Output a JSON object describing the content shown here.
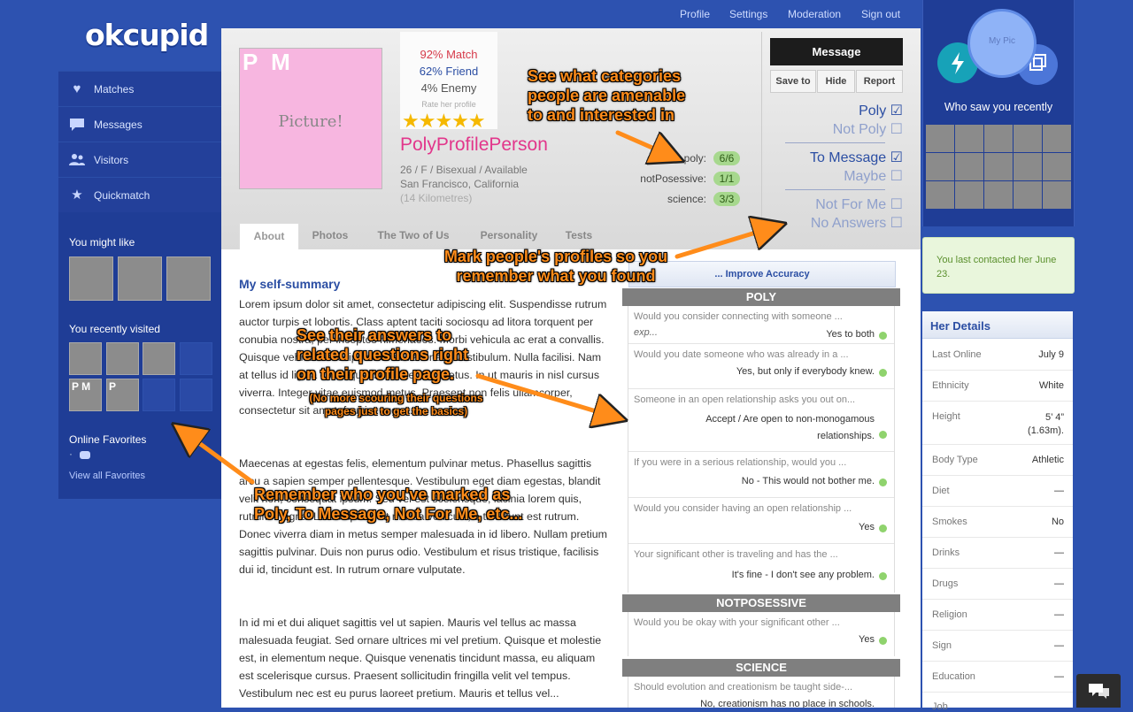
{
  "logo": "okcupid",
  "topnav": [
    "Profile",
    "Settings",
    "Moderation",
    "Sign out"
  ],
  "leftnav": [
    {
      "icon": "heart-icon",
      "glyph": "♥",
      "label": "Matches"
    },
    {
      "icon": "speech-bubble-icon",
      "glyph": "▬",
      "label": "Messages"
    },
    {
      "icon": "people-icon",
      "glyph": "☻",
      "label": "Visitors"
    },
    {
      "icon": "star-icon",
      "glyph": "★",
      "label": "Quickmatch"
    }
  ],
  "left": {
    "might_like": "You might like",
    "recently_visited": "You recently visited",
    "visited_labels": [
      "P M",
      "P"
    ],
    "online_fav": "Online Favorites",
    "online_fav_dot": "·",
    "view_all": "View all Favorites"
  },
  "profile": {
    "initials": "P M",
    "picture": "Picture!",
    "match": "92% Match",
    "friend": "62% Friend",
    "enemy": "4% Enemy",
    "rate": "Rate her profile",
    "stars": "★★★★★",
    "name": "PolyProfilePerson",
    "info": "26 / F / Bisexual / Available",
    "location": "San Francisco, California",
    "distance": "(14 Kilometres)",
    "rating": 5
  },
  "categories": [
    {
      "label": "poly:",
      "value": "6/6"
    },
    {
      "label": "notPosessive:",
      "value": "1/1"
    },
    {
      "label": "science:",
      "value": "3/3"
    }
  ],
  "actions": {
    "message": "Message",
    "save": "Save to",
    "hide": "Hide",
    "report": "Report"
  },
  "marks": [
    {
      "label": "Poly ☑",
      "active": true
    },
    {
      "label": "Not Poly ☐",
      "active": false
    },
    {
      "label": "To Message ☑",
      "active": true
    },
    {
      "label": "Maybe ☐",
      "active": false
    },
    {
      "label": "Not For Me ☐",
      "active": false
    },
    {
      "label": "No Answers ☐",
      "active": false
    }
  ],
  "tabs": [
    "About",
    "Photos",
    "The Two of Us",
    "Personality",
    "Tests"
  ],
  "summary": {
    "title": "My self-summary",
    "p1": "Lorem ipsum dolor sit amet, consectetur adipiscing elit. Suspendisse rutrum auctor turpis et lobortis. Class aptent taciti sociosqu ad litora torquent per conubia nostra, per inceptos himenaeos. Morbi vehicula ac erat a convallis. Quisque vehicula suscipit dolor et venenatis vestibulum. Nulla facilisi. Nam at tellus id ligula consequat sem libero at metus. In ut mauris in nisl cursus viverra. Integer vitae euismod metus. Praesent non felis ullamcorper, consectetur sit amet, feugiat augue.",
    "p2": "Maecenas at egestas felis, elementum pulvinar metus. Phasellus sagittis arcu a sapien semper pellentesque. Vestibulum eget diam egestas, blandit velit non, consequat ipsum. Sed vel est scelerisque, lacinia lorem quis, rutrum magna. Lorem ipsum at massa vehicula, a tincidunt est rutrum. Donec viverra diam in metus semper malesuada in id libero. Nullam pretium sagittis pulvinar. Duis non purus odio. Vestibulum et risus tristique, facilisis dui id, tincidunt est. In rutrum ornare vulputate.",
    "p3": "In id mi et dui aliquet sagittis vel ut sapien. Mauris vel tellus ac massa malesuada feugiat. Sed ornare ultrices mi vel pretium. Quisque et molestie est, in elementum neque. Quisque venenatis tincidunt massa, eu aliquam est scelerisque cursus. Praesent sollicitudin fringilla velit vel tempus. Vestibulum nec est eu purus laoreet pretium. Mauris et tellus vel..."
  },
  "questions": {
    "improve": "... Improve Accuracy",
    "sections": [
      {
        "title": "POLY",
        "items": [
          {
            "q": "Would you consider connecting with someone ...",
            "q2": "exp...",
            "a": "Yes to both"
          },
          {
            "q": "Would you date someone who was already in a ...",
            "a": "Yes, but only if everybody knew."
          },
          {
            "q": "Someone in an open relationship asks you out on...",
            "a": "Accept / Are open to non-monogamous relationships."
          },
          {
            "q": "If you were in a serious relationship, would you ...",
            "a": "No - This would not bother me."
          },
          {
            "q": "Would you consider having an open relationship ...",
            "a": "Yes"
          },
          {
            "q": "Your significant other is traveling and has the ...",
            "a": "It's fine - I don't see any problem."
          }
        ]
      },
      {
        "title": "NOTPOSESSIVE",
        "items": [
          {
            "q": "Would you be okay with your significant other ...",
            "a": "Yes"
          }
        ]
      },
      {
        "title": "SCIENCE",
        "items": [
          {
            "q": "Should evolution and creationism be taught side-...",
            "a": "No, creationism has no place in schools."
          }
        ]
      }
    ]
  },
  "right": {
    "mypic": "My Pic",
    "who_saw": "Who saw you recently",
    "last_contact": "You last contacted her June 23.",
    "details_title": "Her Details",
    "details": [
      {
        "k": "Last Online",
        "v": "July 9"
      },
      {
        "k": "Ethnicity",
        "v": "White"
      },
      {
        "k": "Height",
        "v": "5’ 4” (1.63m)."
      },
      {
        "k": "Body Type",
        "v": "Athletic"
      },
      {
        "k": "Diet",
        "v": "—"
      },
      {
        "k": "Smokes",
        "v": "No"
      },
      {
        "k": "Drinks",
        "v": "—"
      },
      {
        "k": "Drugs",
        "v": "—"
      },
      {
        "k": "Religion",
        "v": "—"
      },
      {
        "k": "Sign",
        "v": "—"
      },
      {
        "k": "Education",
        "v": "—"
      },
      {
        "k": "Job",
        "v": ""
      }
    ]
  },
  "annotations": {
    "a1": "See what categories people are amenable to and interested in",
    "a2": "Mark people's profiles so you remember what you found",
    "a3": "See their answers to related questions right on their profile page.",
    "a3b": "(No more scouring their questions pages just to get the basics)",
    "a4": "Remember who you've marked as Poly, To Message, Not For Me, etc..."
  },
  "colors": {
    "accent": "#2d52b0",
    "name": "#e2368b",
    "annotation": "#ff8c1a",
    "pill": "#a7d88e"
  }
}
